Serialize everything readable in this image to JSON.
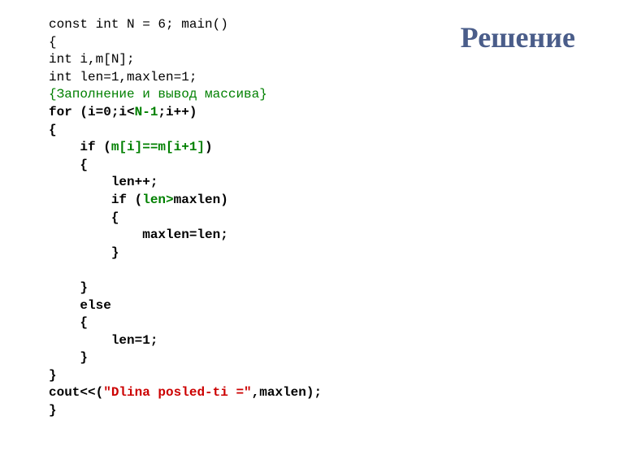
{
  "title": "Решение",
  "code": {
    "l1": "const int N = 6; main()",
    "l2": "{",
    "l3": "int i,m[N];",
    "l4": "int len=1,maxlen=1;",
    "l5": "{Заполнение и вывод массива}",
    "l6a": "for (i=0;i<",
    "l6b": "N-1",
    "l6c": ";i++)",
    "l7": "{",
    "l8a": "    if (",
    "l8b": "m[i]==m[i+1]",
    "l8c": ")",
    "l9": "    {",
    "l10": "        len++;",
    "l11a": "        if (",
    "l11b": "len>",
    "l11c": "maxlen)",
    "l12": "        {",
    "l13": "            maxlen=len;",
    "l14": "        }",
    "l15": "",
    "l16": "    }",
    "l17": "    else",
    "l18": "    {",
    "l19": "        len=1;",
    "l20": "    }",
    "l21": "}",
    "l22a": "cout<<(",
    "l22b": "\"Dlina posled-ti =\"",
    "l22c": ",maxlen);",
    "l23": "}"
  }
}
